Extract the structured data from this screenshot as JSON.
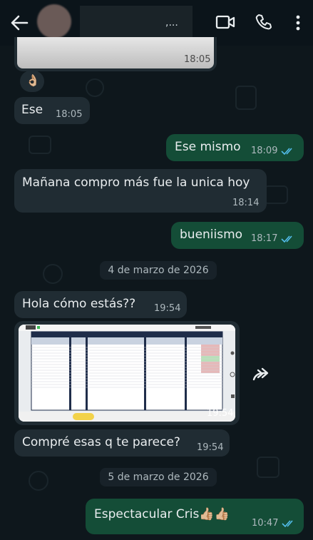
{
  "header": {
    "contact_name": ",...",
    "icons": [
      "back-arrow-icon",
      "video-call-icon",
      "phone-icon",
      "more-options-icon"
    ]
  },
  "messages": [
    {
      "id": "m0",
      "time": "18:05"
    },
    {
      "id": "m1",
      "text": "Ese",
      "time": "18:05"
    },
    {
      "id": "m2",
      "text": "Ese mismo",
      "time": "18:09"
    },
    {
      "id": "m3",
      "text": "Mañana compro más fue la unica hoy",
      "time": "18:14"
    },
    {
      "id": "m4",
      "text": "bueniismo",
      "time": "18:17"
    },
    {
      "id": "m5",
      "text": "Hola cómo estás??",
      "time": "19:54"
    },
    {
      "id": "m6",
      "time": "19:54"
    },
    {
      "id": "m7",
      "text": "Compré esas q te parece?",
      "time": "19:54"
    },
    {
      "id": "m8",
      "text": "Espectacular Cris👍🏼👍🏼",
      "time": "10:47"
    }
  ],
  "dates": {
    "d1": "4 de marzo de 2026",
    "d2": "5 de marzo de 2026"
  },
  "reaction": "👌🏼",
  "colors": {
    "bg": "#0b141a",
    "incoming": "#202c33",
    "outgoing": "#144d37",
    "tick": "#53bdeb"
  }
}
